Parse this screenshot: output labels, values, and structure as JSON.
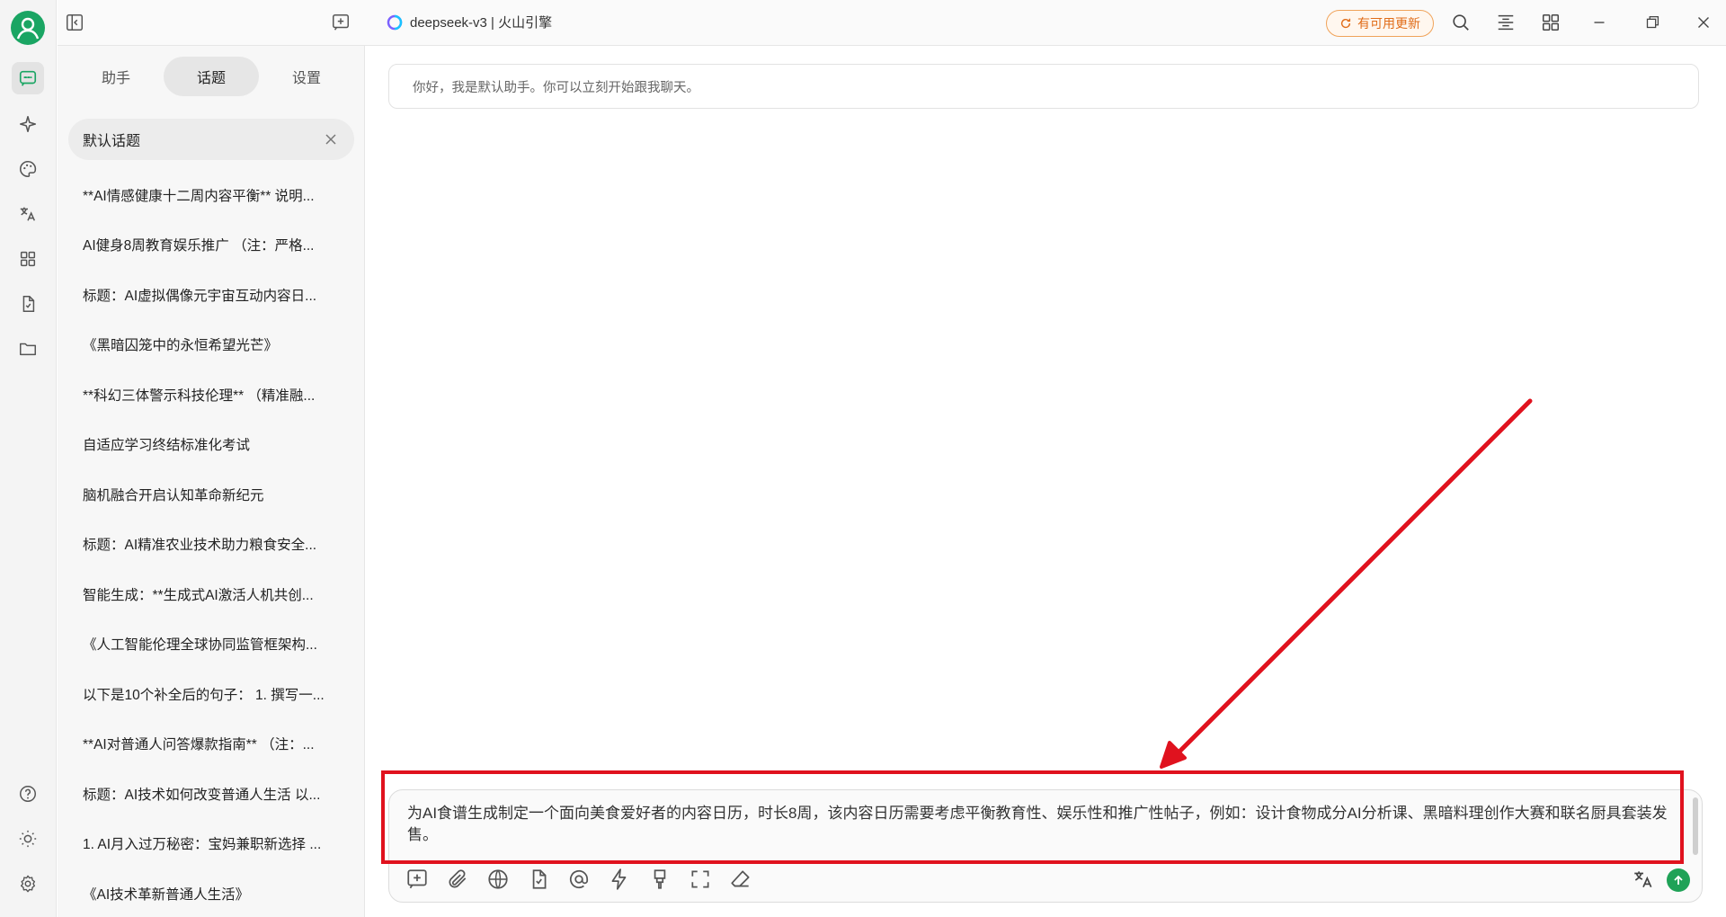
{
  "titlebar": {
    "model_label": "deepseek-v3 | 火山引擎",
    "update_label": "有可用更新"
  },
  "sidebar": {
    "tabs": [
      {
        "label": "助手",
        "active": false
      },
      {
        "label": "话题",
        "active": true
      },
      {
        "label": "设置",
        "active": false
      }
    ],
    "active_topic": "默认话题",
    "topics": [
      "**AI情感健康十二周内容平衡** 说明...",
      "AI健身8周教育娱乐推广 （注：严格...",
      "标题：AI虚拟偶像元宇宙互动内容日...",
      "《黑暗囚笼中的永恒希望光芒》",
      "**科幻三体警示科技伦理** （精准融...",
      "自适应学习终结标准化考试",
      "脑机融合开启认知革命新纪元",
      "标题：AI精准农业技术助力粮食安全...",
      "智能生成：**生成式AI激活人机共创...",
      "《人工智能伦理全球协同监管框架构...",
      "以下是10个补全后的句子： 1. 撰写一...",
      "**AI对普通人问答爆款指南** （注：...",
      "标题：AI技术如何改变普通人生活 以...",
      "1. AI月入过万秘密：宝妈兼职新选择 ...",
      "《AI技术革新普通人生活》"
    ]
  },
  "chat": {
    "welcome_message": "你好，我是默认助手。你可以立刻开始跟我聊天。",
    "composer_text": "为AI食谱生成制定一个面向美食爱好者的内容日历，时长8周，该内容日历需要考虑平衡教育性、娱乐性和推广性帖子，例如：设计食物成分AI分析课、黑暗料理创作大赛和联名厨具套装发售。"
  },
  "colors": {
    "accent_green": "#1aa563",
    "annotation_red": "#e0121e",
    "update_orange": "#e06c18"
  },
  "icons": {
    "rail": [
      "chat-icon",
      "sparkle-icon",
      "palette-icon",
      "translate-icon",
      "apps-icon",
      "document-icon",
      "folder-icon",
      "help-icon",
      "theme-icon",
      "settings-icon"
    ],
    "composer_tools": [
      "new-topic-icon",
      "attachment-icon",
      "web-search-icon",
      "knowledge-icon",
      "mention-icon",
      "quick-phrase-icon",
      "clear-icon",
      "fullscreen-icon",
      "eraser-icon"
    ]
  }
}
